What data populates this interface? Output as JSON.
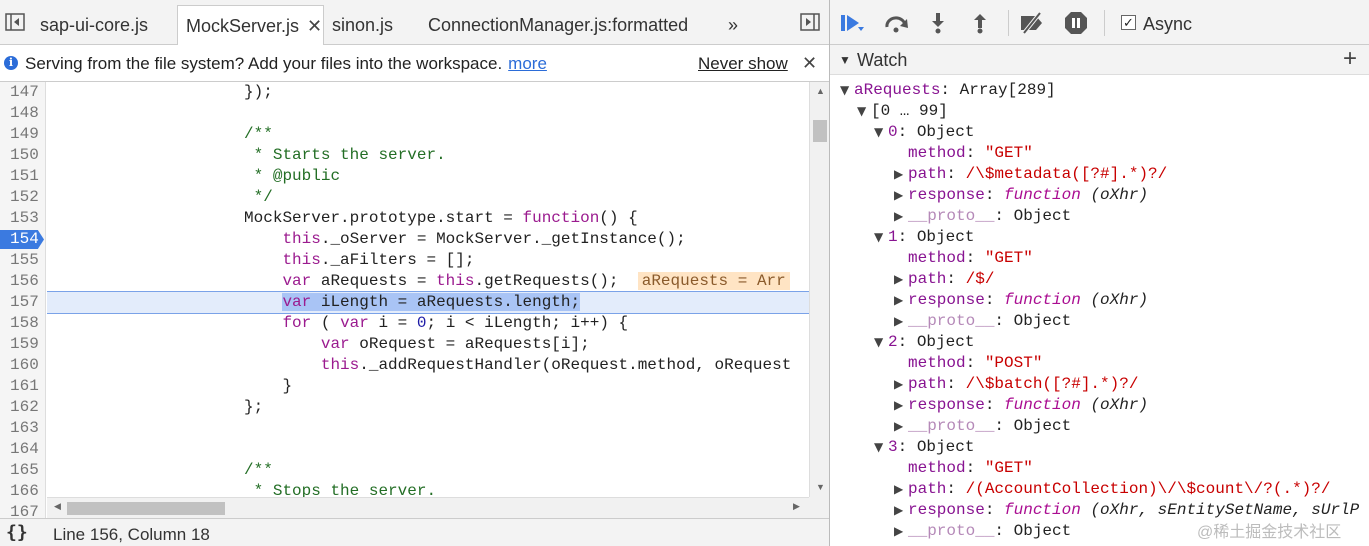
{
  "tabs": [
    {
      "label": "sap-ui-core.js",
      "active": false
    },
    {
      "label": "MockServer.js",
      "active": true
    },
    {
      "label": "sinon.js",
      "active": false
    },
    {
      "label": "ConnectionManager.js:formatted",
      "active": false
    }
  ],
  "tab_close": "✕",
  "tab_more": "»",
  "infobar": {
    "text": "Serving from the file system? Add your files into the workspace.",
    "more": "more",
    "never": "Never show",
    "close": "✕"
  },
  "gutter": [
    "147",
    "148",
    "149",
    "150",
    "151",
    "152",
    "153",
    "154",
    "155",
    "156",
    "157",
    "158",
    "159",
    "160",
    "161",
    "162",
    "163",
    "164",
    "165",
    "166",
    "167"
  ],
  "breakpoint_line": "154",
  "code": {
    "l147": "                    });",
    "l149": "                    /**",
    "l150": "                     * Starts the server.",
    "l151": "                     * @public",
    "l152": "                     */",
    "l153a": "                    MockServer.prototype.start = ",
    "l153kw": "function",
    "l153b": "() {",
    "l154kw": "this",
    "l154b": "._oServer = MockServer._getInstance();",
    "l155kw": "this",
    "l155b": "._aFilters = [];",
    "l156kw1": "var",
    "l156b": " aRequests = ",
    "l156kw2": "this",
    "l156c": ".getRequests();",
    "l156inline": "aRequests = Arr",
    "l157kw": "var",
    "l157b": " iLength = aRequests.length;",
    "l158kw1": "for",
    "l158b": " ( ",
    "l158kw2": "var",
    "l158c": " i = ",
    "l158num": "0",
    "l158d": "; i < iLength; i++) {",
    "l159kw": "var",
    "l159b": " oRequest = aRequests[i];",
    "l160kw": "this",
    "l160b": "._addRequestHandler(oRequest.method, oRequest",
    "l161": "                        }",
    "l162": "                    };",
    "l165": "                    /**",
    "l166": "                     * Stops the server."
  },
  "status": {
    "braces": "{}",
    "position": "Line 156, Column 18"
  },
  "debugger": {
    "async_label": "Async",
    "async_checked": "✓"
  },
  "watch": {
    "title": "Watch",
    "add": "+",
    "root_key": "aRequests",
    "root_val": "Array[289]",
    "range": "[0 … 99]",
    "items": [
      {
        "idx": "0",
        "type": "Object",
        "method": "\"GET\"",
        "path": "/\\$metadata([?#].*)?/",
        "resp_args": "(oXhr)"
      },
      {
        "idx": "1",
        "type": "Object",
        "method": "\"GET\"",
        "path": "/$/",
        "resp_args": "(oXhr)"
      },
      {
        "idx": "2",
        "type": "Object",
        "method": "\"POST\"",
        "path": "/\\$batch([?#].*)?/",
        "resp_args": "(oXhr)"
      },
      {
        "idx": "3",
        "type": "Object",
        "method": "\"GET\"",
        "path": "/(AccountCollection)\\/\\$count\\/?(.*)?/",
        "resp_args": "(oXhr, sEntitySetName, sUrlP"
      }
    ],
    "k_method": "method",
    "k_path": "path",
    "k_response": "response",
    "k_proto": "__proto__",
    "fn_kw": "function",
    "proto_val": "Object"
  },
  "watermark": "@稀土掘金技术社区"
}
